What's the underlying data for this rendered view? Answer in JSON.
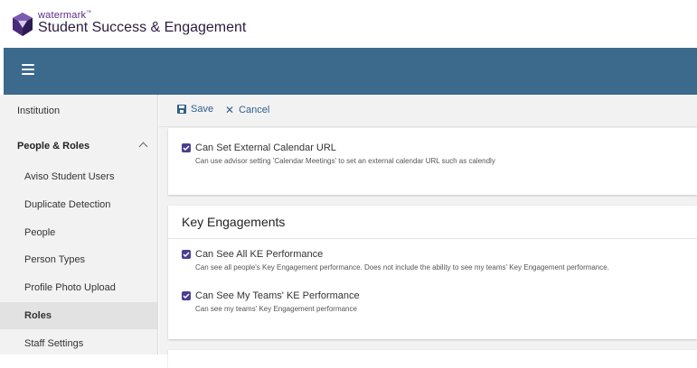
{
  "brand": {
    "small": "watermark",
    "tm": "™",
    "name": "Student Success & Engagement"
  },
  "colors": {
    "topbar": "#3b6a8d",
    "checkbox": "#4b3e8e",
    "link": "#2f5f8a"
  },
  "sidebar": {
    "items": [
      {
        "label": "Institution"
      },
      {
        "label": "People & Roles"
      },
      {
        "label": "Aviso Student Users"
      },
      {
        "label": "Duplicate Detection"
      },
      {
        "label": "People"
      },
      {
        "label": "Person Types"
      },
      {
        "label": "Profile Photo Upload"
      },
      {
        "label": "Roles"
      },
      {
        "label": "Staff Settings"
      }
    ]
  },
  "toolbar": {
    "save_label": "Save",
    "cancel_label": "Cancel"
  },
  "card1": {
    "perm": {
      "title": "Can Set External Calendar URL",
      "desc": "Can use advisor setting 'Calendar Meetings' to set an external calendar URL such as calendly",
      "checked": true
    }
  },
  "card2": {
    "title": "Key Engagements",
    "perms": [
      {
        "title": "Can See All KE Performance",
        "desc": "Can see all people's Key Engagement performance. Does not include the ability to see my teams' Key Engagement performance.",
        "checked": true
      },
      {
        "title": "Can See My Teams' KE Performance",
        "desc": "Can see my teams' Key Engagement performance",
        "checked": true
      }
    ]
  }
}
